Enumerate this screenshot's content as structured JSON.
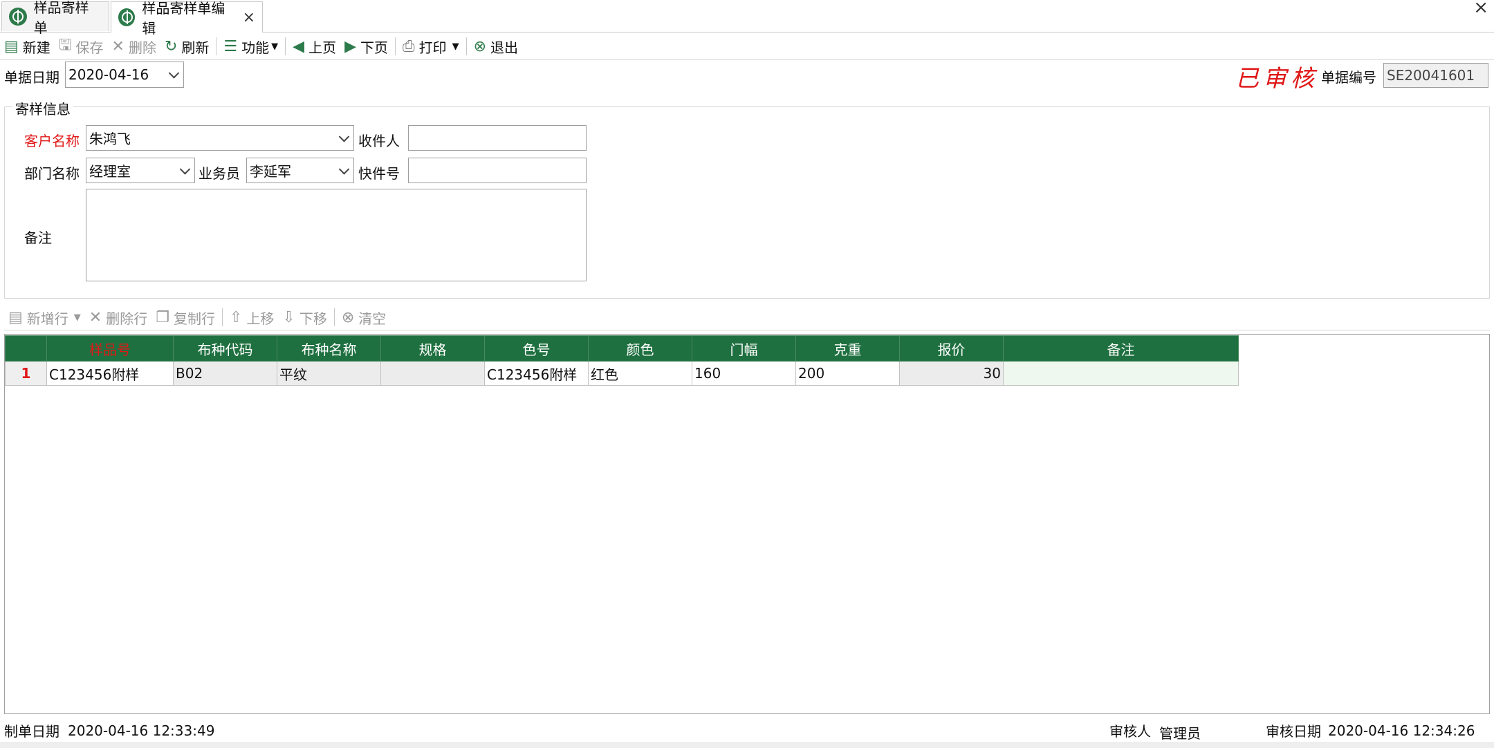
{
  "tabs": [
    {
      "label": "样品寄样单"
    },
    {
      "label": "样品寄样单编辑",
      "close": "×"
    }
  ],
  "window_close": "×",
  "toolbar": {
    "new": "新建",
    "save": "保存",
    "delete": "删除",
    "refresh": "刷新",
    "function": "功能",
    "prev": "上页",
    "next": "下页",
    "print": "打印",
    "exit": "退出"
  },
  "header": {
    "date_label": "单据日期",
    "date_value": "2020-04-16",
    "status_stamp": "已审核",
    "docno_label": "单据编号",
    "docno_value": "SE20041601"
  },
  "group": {
    "title": "寄样信息",
    "customer_label": "客户名称",
    "customer_value": "朱鸿飞",
    "recipient_label": "收件人",
    "recipient_value": "",
    "dept_label": "部门名称",
    "dept_value": "经理室",
    "salesman_label": "业务员",
    "salesman_value": "李延军",
    "express_label": "快件号",
    "express_value": "",
    "remark_label": "备注",
    "remark_value": ""
  },
  "grid_toolbar": {
    "add_row": "新增行",
    "delete_row": "删除行",
    "copy_row": "复制行",
    "move_up": "上移",
    "move_down": "下移",
    "clear": "清空"
  },
  "grid": {
    "columns": [
      "样品号",
      "布种代码",
      "布种名称",
      "规格",
      "色号",
      "颜色",
      "门幅",
      "克重",
      "报价",
      "备注"
    ],
    "rows": [
      {
        "index": "1",
        "sample_no": "C123456附样",
        "fabric_code": "B02",
        "fabric_name": "平纹",
        "spec": "",
        "color_no": "C123456附样",
        "color": "红色",
        "width": "160",
        "weight": "200",
        "price": "30",
        "note": ""
      }
    ]
  },
  "footer": {
    "created_label": "制单日期",
    "created_value": "2020-04-16 12:33:49",
    "auditor_label": "审核人",
    "auditor_value": "管理员",
    "audit_date_label": "审核日期",
    "audit_date_value": "2020-04-16 12:34:26"
  },
  "colors": {
    "grid_header": "#1f7040",
    "required_label": "#e01818",
    "stamp": "#e01818"
  }
}
